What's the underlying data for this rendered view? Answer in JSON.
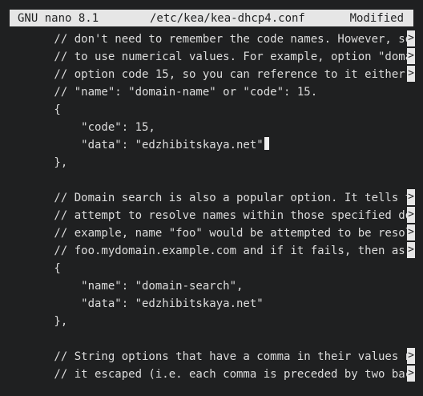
{
  "titlebar": {
    "app": "GNU nano 8.1",
    "file": "/etc/kea/kea-dhcp4.conf",
    "status": "Modified"
  },
  "editor": {
    "overflow_glyph": ">",
    "lines": [
      "        // don't need to remember the code names. However, so",
      "        // to use numerical values. For example, option \"doma",
      "        // option code 15, so you can reference to it either",
      "        // \"name\": \"domain-name\" or \"code\": 15.",
      "        {",
      "            \"code\": 15,",
      "            \"data\": \"edzhibitskaya.net\"",
      "        },",
      "",
      "        // Domain search is also a popular option. It tells t",
      "        // attempt to resolve names within those specified do",
      "        // example, name \"foo\" would be attempted to be resol",
      "        // foo.mydomain.example.com and if it fails, then as",
      "        {",
      "            \"name\": \"domain-search\",",
      "            \"data\": \"edzhibitskaya.net\"",
      "        },",
      "",
      "        // String options that have a comma in their values n",
      "        // it escaped (i.e. each comma is preceded by two bac"
    ]
  }
}
